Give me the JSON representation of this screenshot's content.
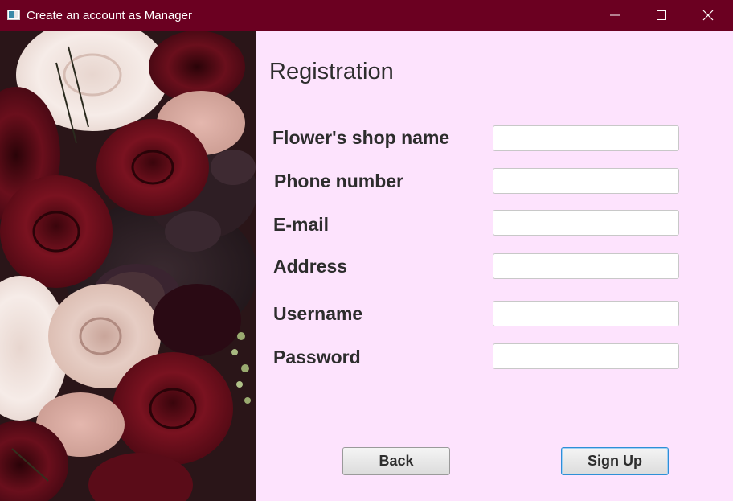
{
  "window": {
    "title": "Create an account as Manager",
    "icons": {
      "app": "app-window-icon",
      "minimize": "minimize-icon",
      "maximize": "maximize-icon",
      "close": "close-icon"
    }
  },
  "photo": {
    "subject": "bouquet of roses (dark red, blush, cream)"
  },
  "form": {
    "heading": "Registration",
    "fields": [
      {
        "label": "Flower's shop name",
        "value": ""
      },
      {
        "label": "Phone number",
        "value": ""
      },
      {
        "label": "E-mail",
        "value": ""
      },
      {
        "label": "Address",
        "value": ""
      },
      {
        "label": "Username",
        "value": ""
      },
      {
        "label": "Password",
        "value": ""
      }
    ],
    "buttons": {
      "back": "Back",
      "signup": "Sign Up"
    }
  },
  "colors": {
    "titlebar": "#6b0021",
    "form_background": "#fde3fd",
    "focus_accent": "#2e8fd6"
  }
}
